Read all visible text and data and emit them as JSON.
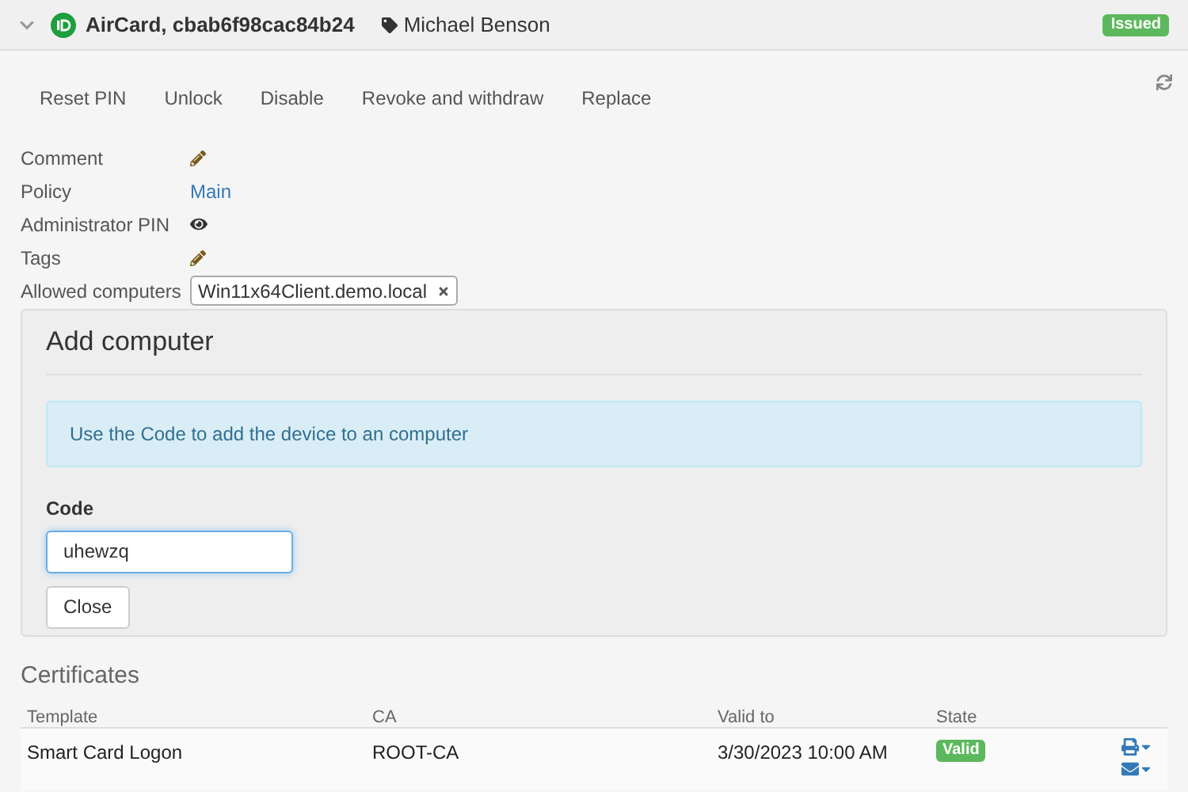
{
  "header": {
    "expanded": true,
    "title": "AirCard, cbab6f98cac84b24",
    "owner": "Michael Benson",
    "status": "Issued"
  },
  "actions": [
    "Reset PIN",
    "Unlock",
    "Disable",
    "Revoke and withdraw",
    "Replace"
  ],
  "properties": [
    {
      "label": "Comment",
      "kind": "edit"
    },
    {
      "label": "Policy",
      "kind": "link",
      "value": "Main"
    },
    {
      "label": "Administrator PIN",
      "kind": "reveal"
    },
    {
      "label": "Tags",
      "kind": "edit"
    },
    {
      "label": "Allowed computers",
      "kind": "chips",
      "chips": [
        "Win11x64Client.demo.local"
      ]
    }
  ],
  "add_computer": {
    "title": "Add computer",
    "info": "Use the Code to add the device to an computer",
    "code_label": "Code",
    "code_value": "uhewzq",
    "close": "Close"
  },
  "certificates": {
    "title": "Certificates",
    "columns": [
      "Template",
      "CA",
      "Valid to",
      "State"
    ],
    "rows": [
      {
        "template": "Smart Card Logon",
        "ca": "ROOT-CA",
        "valid_to": "3/30/2023 10:00 AM",
        "state": "Valid"
      }
    ]
  }
}
